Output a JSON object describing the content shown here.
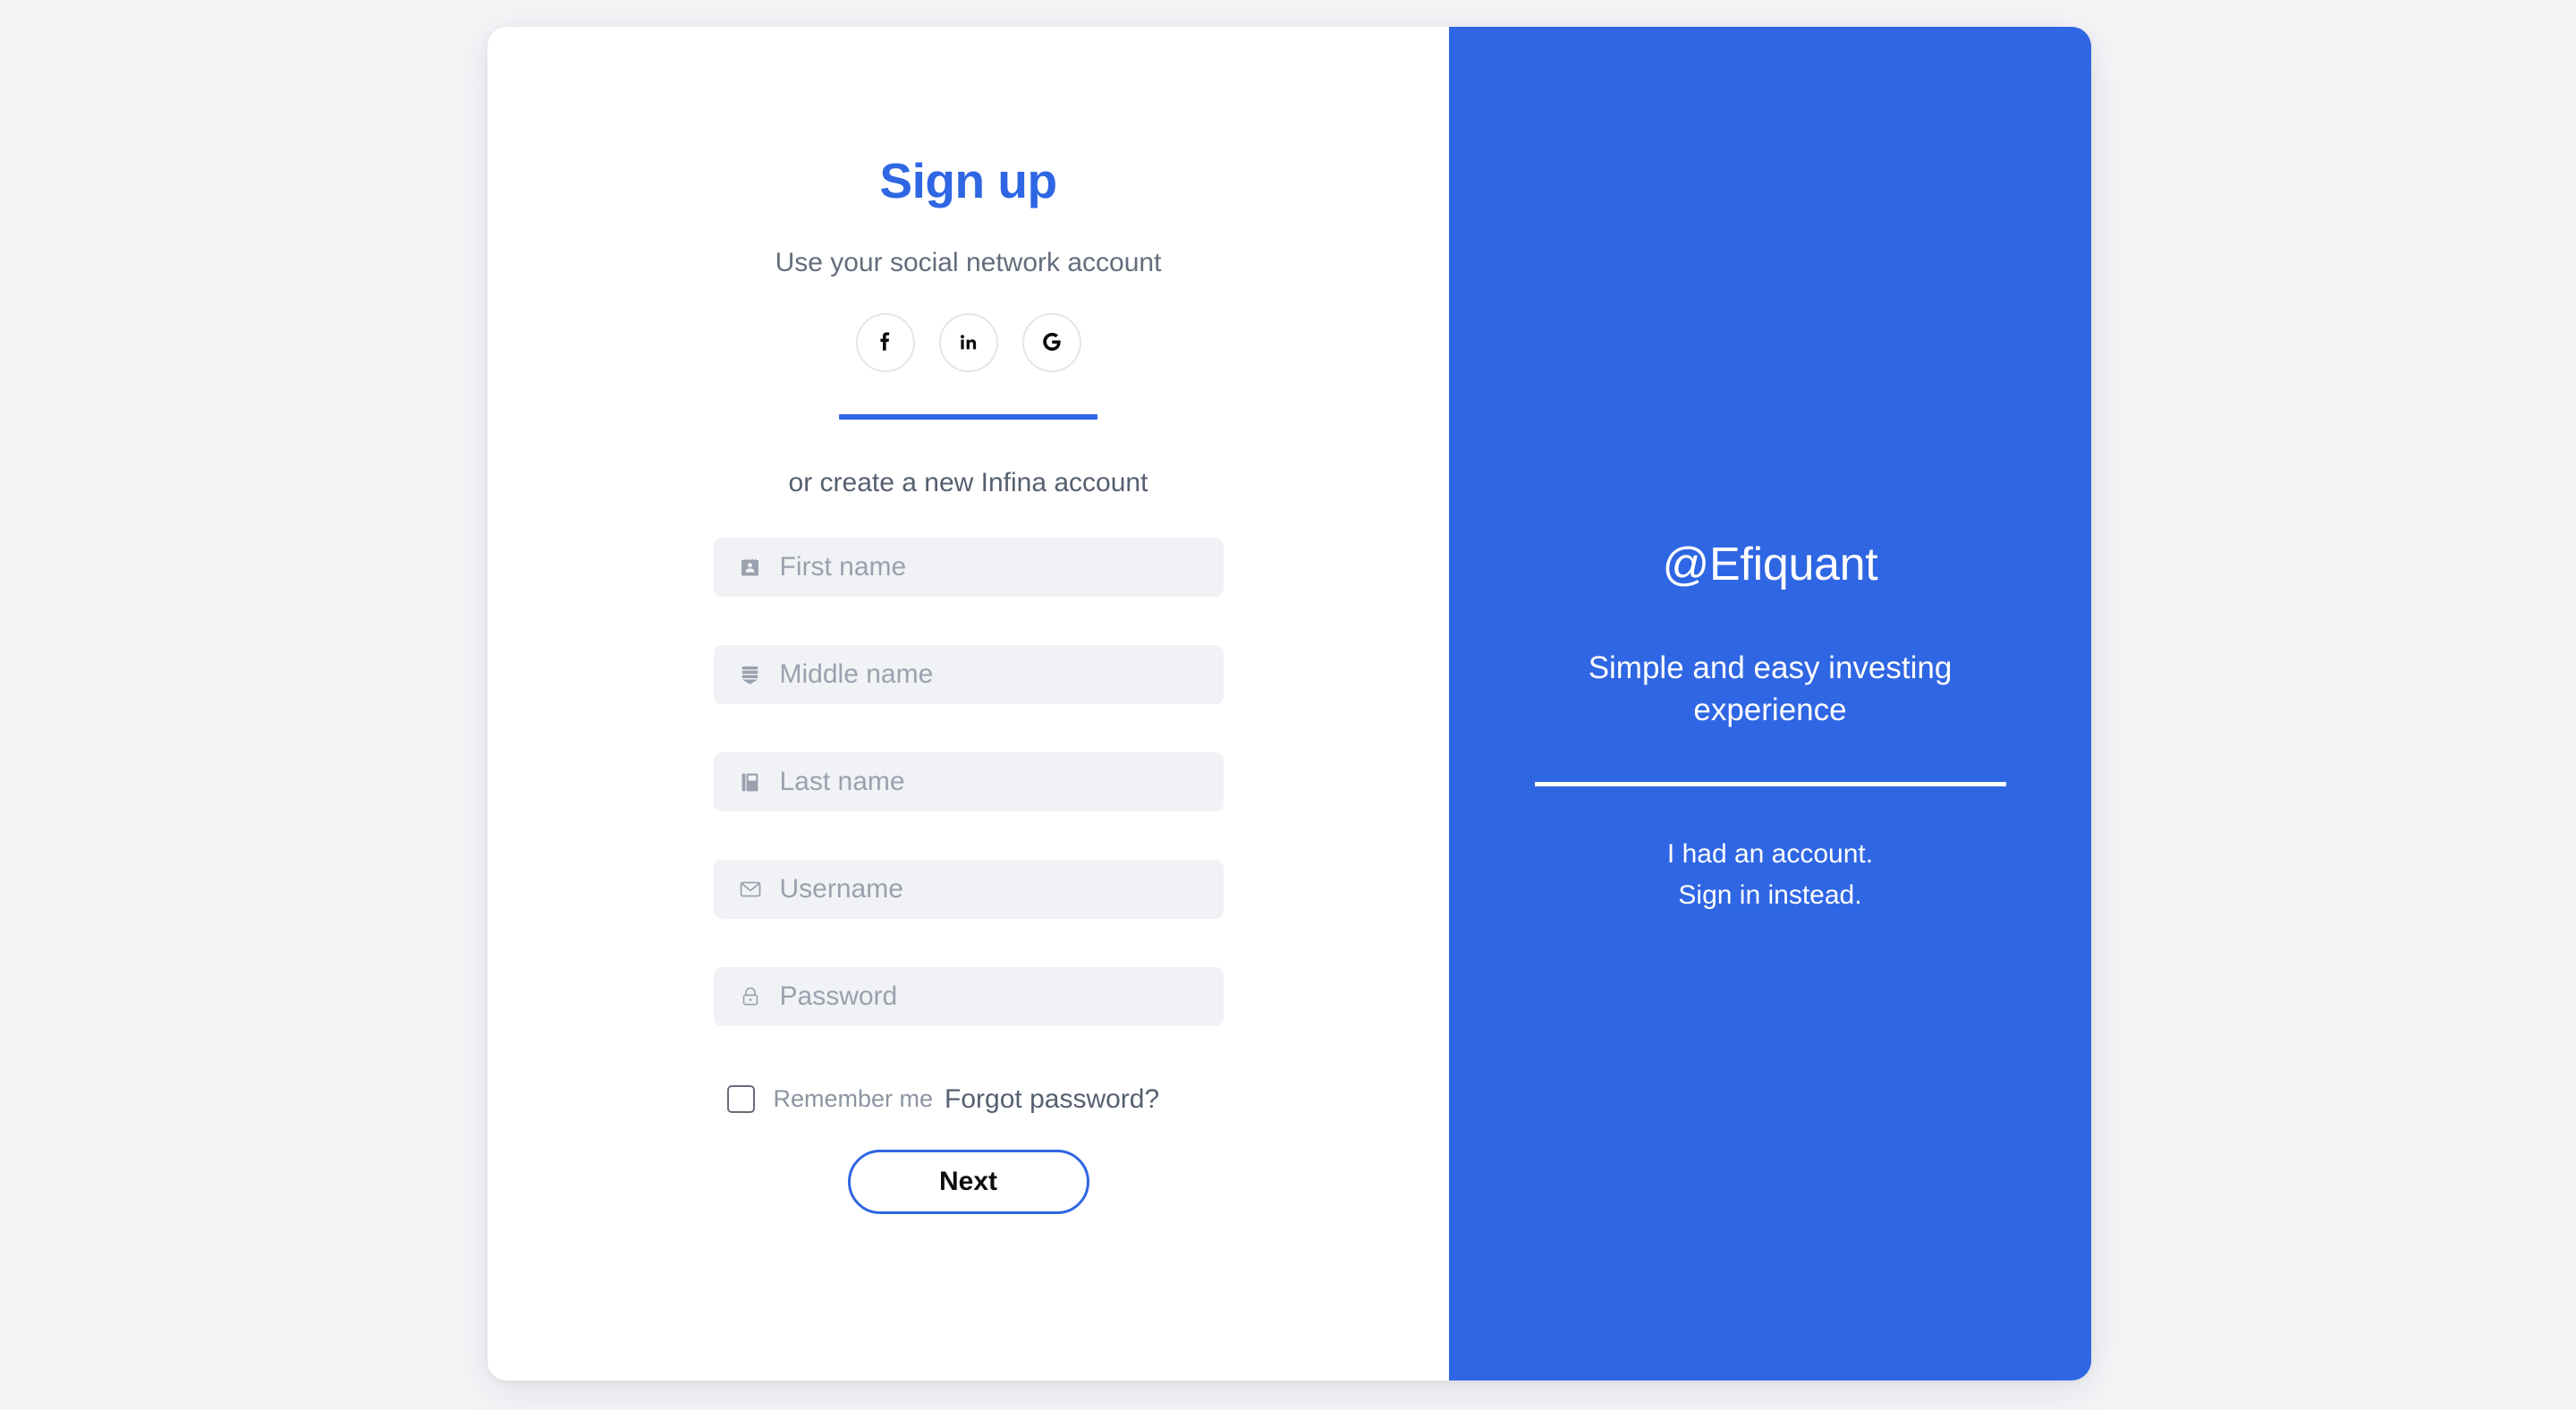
{
  "theme": {
    "accent_blue": "#2f66e3",
    "page_background": "#f4f5f7",
    "card_background": "#ffffff",
    "field_background": "#f1f2f5",
    "placeholder_color": "#9aa1ae",
    "muted_text": "#646d7d"
  },
  "signup": {
    "title": "Sign up",
    "social_prompt": "Use your social network account",
    "social_buttons": [
      {
        "id": "facebook",
        "icon": "facebook-icon",
        "glyph": "f",
        "label": "Sign up with Facebook"
      },
      {
        "id": "linkedin",
        "icon": "linkedin-icon",
        "glyph": "in",
        "label": "Sign up with LinkedIn"
      },
      {
        "id": "google",
        "icon": "google-icon",
        "glyph": "G",
        "label": "Sign up with Google"
      }
    ],
    "create_prompt": "or create a new Infina account",
    "fields": [
      {
        "id": "first-name",
        "placeholder": "First name",
        "value": "",
        "icon": "id-badge-icon"
      },
      {
        "id": "middle-name",
        "placeholder": "Middle name",
        "value": "",
        "icon": "document-list-icon"
      },
      {
        "id": "last-name",
        "placeholder": "Last name",
        "value": "",
        "icon": "notebook-icon"
      },
      {
        "id": "username",
        "placeholder": "Username",
        "value": "",
        "icon": "envelope-icon"
      },
      {
        "id": "password",
        "placeholder": "Password",
        "value": "",
        "icon": "lock-icon"
      }
    ],
    "remember_me_label": "Remember me",
    "remember_me_checked": false,
    "forgot_password_label": "Forgot password?",
    "submit_label": "Next"
  },
  "brand": {
    "name": "@Efiquant",
    "tagline": "Simple and easy investing experience",
    "switch_line_1": "I had an account.",
    "switch_line_2": "Sign in instead."
  }
}
